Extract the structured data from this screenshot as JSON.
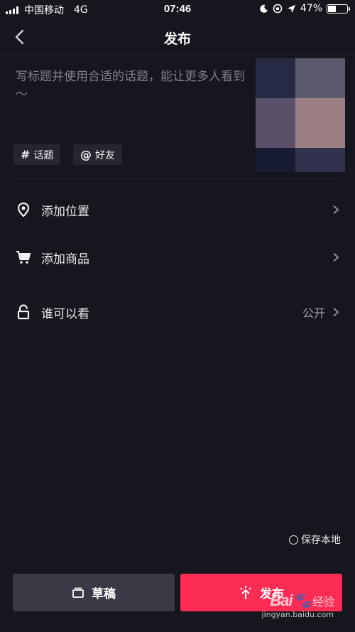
{
  "status_bar": {
    "carrier": "中国移动",
    "network": "4G",
    "time": "07:46",
    "battery_text": "47%",
    "battery_level": 0.47
  },
  "header": {
    "title": "发布"
  },
  "composer": {
    "placeholder": "写标题并使用合适的话题，能让更多人看到～"
  },
  "chips": [
    {
      "icon": "#",
      "label": "话题"
    },
    {
      "icon": "@",
      "label": "好友"
    }
  ],
  "options": [
    {
      "label": "添加位置",
      "value": ""
    },
    {
      "label": "添加商品",
      "value": ""
    },
    {
      "label": "谁可以看",
      "value": "公开"
    }
  ],
  "save_local": "保存本地",
  "buttons": {
    "draft": "草稿",
    "publish": "发布"
  },
  "watermark": {
    "logo_latin": "Bai",
    "logo_cn": "经验",
    "url": "jingyan.baidu.com"
  },
  "colors": {
    "background": "#16161f",
    "accent": "#fc2c55",
    "draft_button": "#3a3a46"
  }
}
